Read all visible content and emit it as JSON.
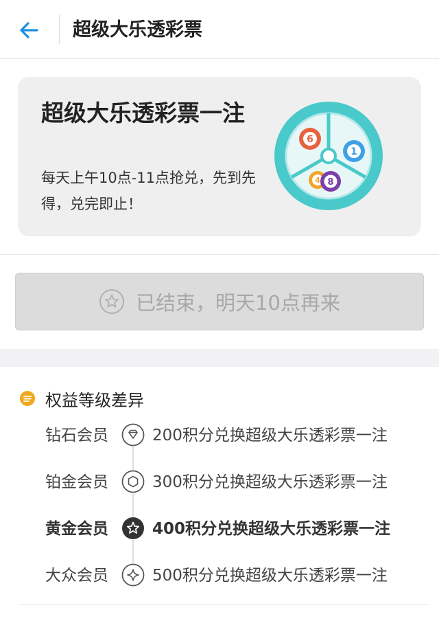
{
  "header": {
    "title": "超级大乐透彩票"
  },
  "card": {
    "title": "超级大乐透彩票一注",
    "description": "每天上午10点-11点抢兑，先到先得，兑完即止！",
    "balls": [
      "6",
      "1",
      "4",
      "8"
    ]
  },
  "status_button": {
    "label": "已结束，明天10点再来"
  },
  "section": {
    "title": "权益等级差异"
  },
  "tiers": [
    {
      "name": "钻石会员",
      "benefit": "200积分兑换超级大乐透彩票一注",
      "icon": "diamond-icon"
    },
    {
      "name": "铂金会员",
      "benefit": "300积分兑换超级大乐透彩票一注",
      "icon": "hexagon-icon"
    },
    {
      "name": "黄金会员",
      "benefit": "400积分兑换超级大乐透彩票一注",
      "icon": "star-icon"
    },
    {
      "name": "大众会员",
      "benefit": "500积分兑换超级大乐透彩票一注",
      "icon": "sparkle-icon"
    }
  ],
  "colors": {
    "accent_blue": "#1a8fe3",
    "icon_teal": "#49c9c9",
    "chat_icon_yellow": "#f0a81c"
  }
}
